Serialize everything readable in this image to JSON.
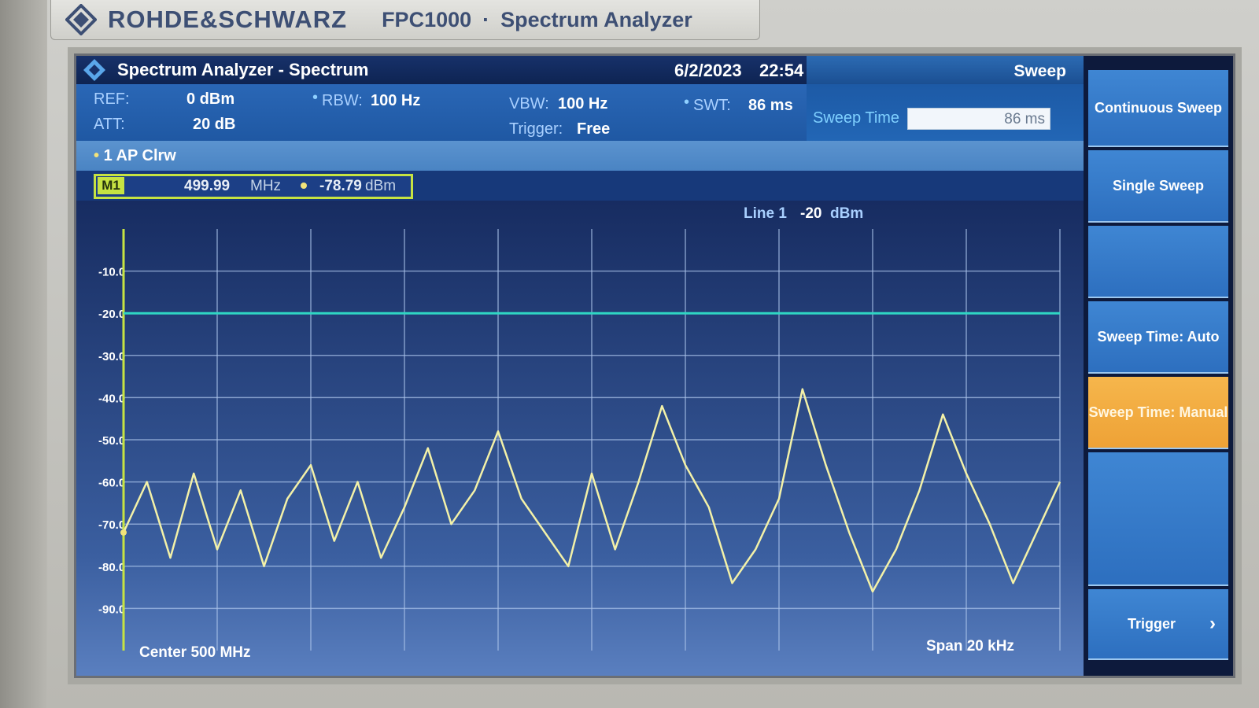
{
  "device": {
    "brand": "ROHDE&SCHWARZ",
    "model": "FPC1000",
    "separator": "·",
    "type": "Spectrum Analyzer"
  },
  "titlebar": {
    "title": "Spectrum Analyzer - Spectrum",
    "date": "6/2/2023",
    "time": "22:54",
    "menu": "Sweep"
  },
  "params": {
    "ref_label": "REF:",
    "ref_value": "0 dBm",
    "att_label": "ATT:",
    "att_value": "20 dB",
    "rbw_label": "RBW:",
    "rbw_value": "100 Hz",
    "vbw_label": "VBW:",
    "vbw_value": "100 Hz",
    "trigger_label": "Trigger:",
    "trigger_value": "Free",
    "swt_label": "SWT:",
    "swt_value": "86 ms"
  },
  "sweep_input": {
    "label": "Sweep Time",
    "value": "86 ms"
  },
  "trace": {
    "label": "1 AP Clrw"
  },
  "marker": {
    "id": "M1",
    "freq": "499.99",
    "freq_unit": "MHz",
    "level": "-78.79",
    "level_unit": "dBm"
  },
  "display_line": {
    "label": "Line 1",
    "value": "-20",
    "unit": "dBm"
  },
  "footer": {
    "center": "Center 500 MHz",
    "span": "Span 20 kHz"
  },
  "softkeys": [
    {
      "label": "Continuous Sweep",
      "active": false
    },
    {
      "label": "Single Sweep",
      "active": false
    },
    {
      "label": "",
      "active": false
    },
    {
      "label": "Sweep Time: Auto",
      "active": false
    },
    {
      "label": "Sweep Time: Manual",
      "active": true
    },
    {
      "label": "",
      "active": false
    },
    {
      "label": "Trigger",
      "active": false
    }
  ],
  "colors": {
    "trace": "#f3f1a8",
    "display_line": "#2fd6c3",
    "marker": "#c6e342",
    "softkey_active": "#eea236"
  },
  "chart_data": {
    "type": "line",
    "y_ticks": [
      "-10.0",
      "-20.0",
      "-30.0",
      "-40.0",
      "-50.0",
      "-60.0",
      "-70.0",
      "-80.0",
      "-90.0"
    ],
    "ylim": [
      -100,
      0
    ],
    "xlim": [
      499.99,
      500.01
    ],
    "x_unit": "MHz",
    "y_unit": "dBm",
    "grid": true,
    "vertical_divisions": 10,
    "threshold_line": -20,
    "series": [
      {
        "x": [
          499.99,
          499.9905,
          499.991,
          499.9915,
          499.992,
          499.9925,
          499.993,
          499.9935,
          499.994,
          499.9945,
          499.995,
          499.9955,
          499.996,
          499.9965,
          499.997,
          499.9975,
          499.998,
          499.9985,
          499.999,
          499.9995,
          500.0,
          500.0005,
          500.001,
          500.0015,
          500.002,
          500.0025,
          500.003,
          500.0035,
          500.004,
          500.0045,
          500.005,
          500.0055,
          500.006,
          500.0065,
          500.007,
          500.0075,
          500.008,
          500.0085,
          500.009,
          500.0095,
          500.01
        ],
        "y": [
          -72,
          -60,
          -78,
          -58,
          -76,
          -62,
          -80,
          -64,
          -56,
          -74,
          -60,
          -78,
          -66,
          -52,
          -70,
          -62,
          -48,
          -64,
          -72,
          -80,
          -58,
          -76,
          -60,
          -42,
          -56,
          -66,
          -84,
          -76,
          -64,
          -38,
          -56,
          -72,
          -86,
          -76,
          -62,
          -44,
          -58,
          -70,
          -84,
          -72,
          -60
        ]
      }
    ]
  }
}
